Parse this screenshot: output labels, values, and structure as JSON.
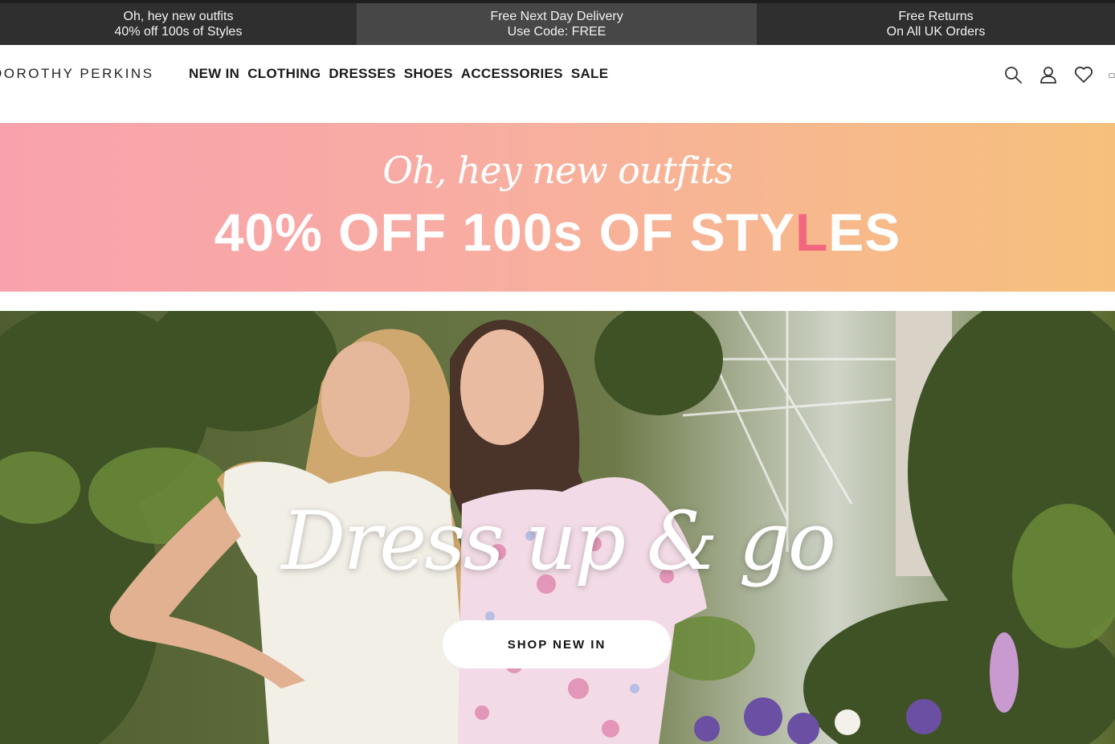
{
  "promo_strip": [
    {
      "line1": "Oh, hey new outfits",
      "line2": "40% off 100s of Styles"
    },
    {
      "line1": "Free Next Day Delivery",
      "line2": "Use Code: FREE"
    },
    {
      "line1": "Free Returns",
      "line2": "On All UK Orders"
    }
  ],
  "header": {
    "logo": "DOROTHY PERKINS",
    "nav": [
      "NEW IN",
      "CLOTHING",
      "DRESSES",
      "SHOES",
      "ACCESSORIES",
      "SALE"
    ],
    "icons": [
      "search-icon",
      "account-icon",
      "wishlist-icon",
      "bag-icon"
    ]
  },
  "banner": {
    "script": "Oh, hey new outfits",
    "headline_part1": "40% OFF 100s OF STY",
    "headline_accent": "L",
    "headline_part2": "ES",
    "accent_color": "#f2677f"
  },
  "hero": {
    "title": "Dress up & go",
    "cta": "SHOP NEW IN"
  }
}
